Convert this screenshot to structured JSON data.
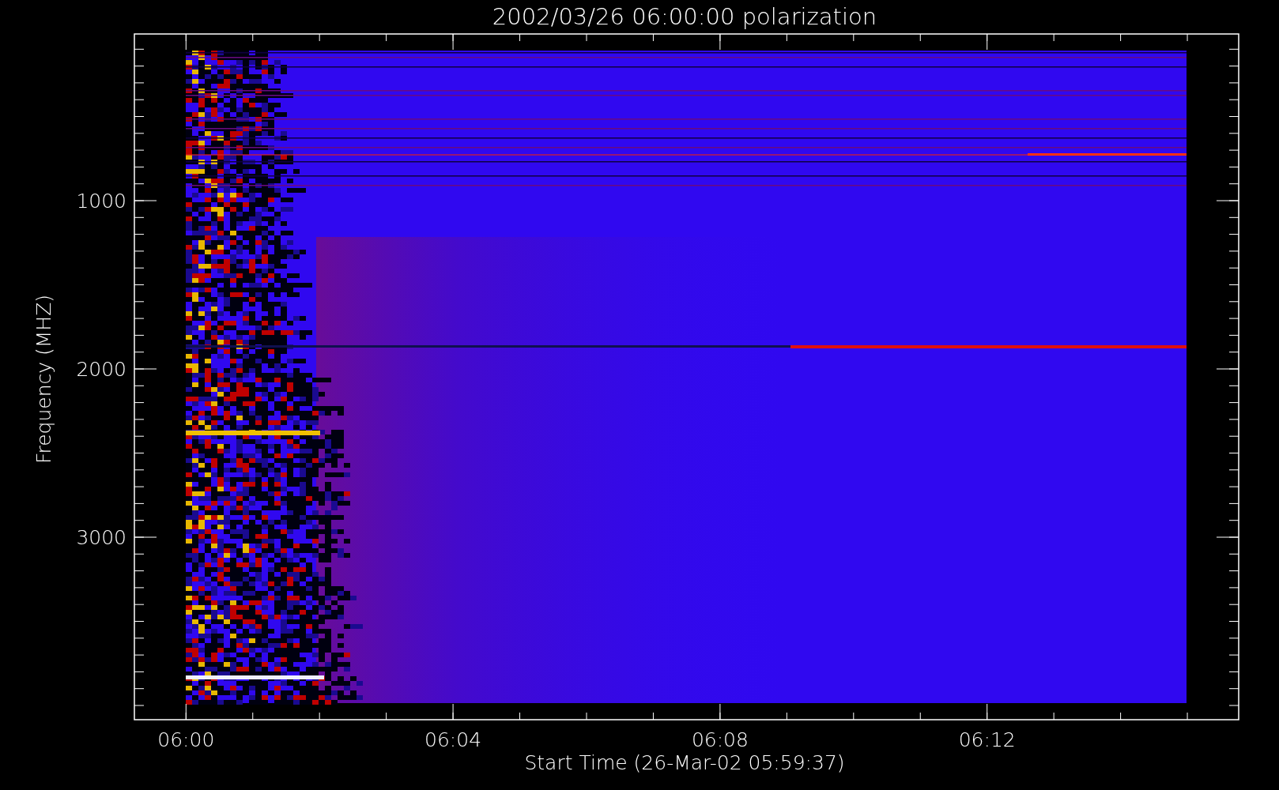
{
  "title": "2002/03/26 06:00:00 polarization",
  "x_axis": {
    "label": "Start Time (26-Mar-02 05:59:37)",
    "ticks": [
      "06:00",
      "06:04",
      "06:08",
      "06:12"
    ]
  },
  "y_axis": {
    "label": "Frequency (MHZ)",
    "ticks": [
      "1000",
      "2000",
      "3000"
    ]
  }
}
